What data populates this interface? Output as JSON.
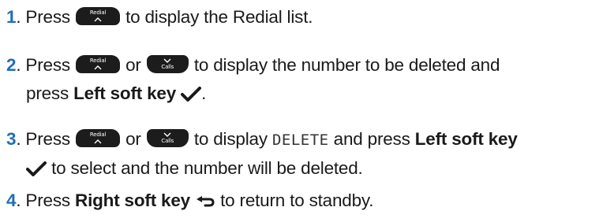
{
  "steps": [
    {
      "number": "1",
      "t1": ". Press",
      "key1": "Redial",
      "t2": "to display the Redial list."
    },
    {
      "number": "2",
      "t1": ". Press",
      "key1": "Redial",
      "t2": "or",
      "key2": "Calls",
      "t3": "to display the number to be deleted and",
      "t4": "press",
      "bold1": "Left soft key",
      "t5": "."
    },
    {
      "number": "3",
      "t1": ". Press",
      "key1": "Redial",
      "t2": "or",
      "key2": "Calls",
      "t3": "to display",
      "mono": "DELETE",
      "t4": "and press",
      "bold1": "Left soft key",
      "t5": "to select and the number will be deleted."
    },
    {
      "number": "4",
      "t1": ". Press",
      "bold1": "Right soft key",
      "t2": "to return to standby."
    }
  ],
  "colors": {
    "step_number": "#1f6fb5",
    "text": "#1a1a1a",
    "key_background": "#1c1c1c",
    "key_text": "#ffffff"
  },
  "icons": {
    "redial_key": "redial-up-key-icon",
    "calls_key": "calls-down-key-icon",
    "left_soft_key": "checkmark-icon",
    "right_soft_key": "back-arrow-icon"
  }
}
